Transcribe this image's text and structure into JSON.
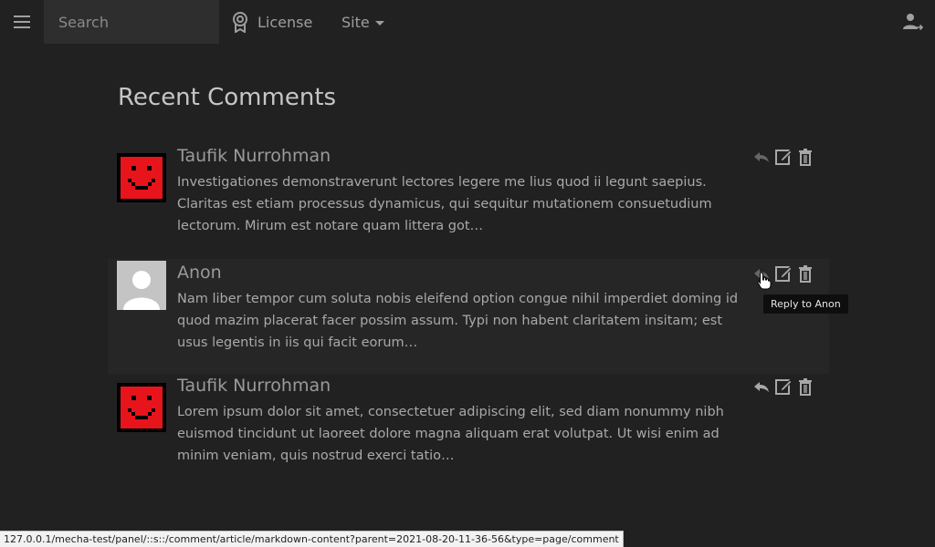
{
  "topbar": {
    "search_placeholder": "Search",
    "license_label": "License",
    "site_label": "Site",
    "menu_icon": "hamburger-menu-icon",
    "user_icon": "user-login-icon"
  },
  "page": {
    "title": "Recent Comments"
  },
  "comments": [
    {
      "author": "Taufik Nurrohman",
      "text": "Investigationes demonstraverunt lectores legere me lius quod ii legunt saepius. Claritas est etiam processus dynamicus, qui sequitur mutationem consuetudium lectorum. Mirum est notare quam littera got…",
      "avatar": "red-smiley-avatar"
    },
    {
      "author": "Anon",
      "text": "Nam liber tempor cum soluta nobis eleifend option congue nihil imperdiet doming id quod mazim placerat facer possim assum. Typi non habent claritatem insitam; est usus legentis in iis qui facit eorum…",
      "avatar": "default-person-avatar"
    },
    {
      "author": "Taufik Nurrohman",
      "text": "Lorem ipsum dolor sit amet, consectetuer adipiscing elit, sed diam nonummy nibh euismod tincidunt ut laoreet dolore magna aliquam erat volutpat. Ut wisi enim ad minim veniam, quis nostrud exerci tatio…",
      "avatar": "red-smiley-avatar"
    }
  ],
  "tooltip": {
    "text": "Reply to Anon"
  },
  "statusbar": {
    "url": "127.0.0.1/mecha-test/panel/::s::/comment/article/markdown-content?parent=2021-08-20-11-36-56&type=page/comment"
  },
  "colors": {
    "background": "#212121",
    "search_bg": "#2e2e2e",
    "avatar_red": "#e8141c"
  }
}
